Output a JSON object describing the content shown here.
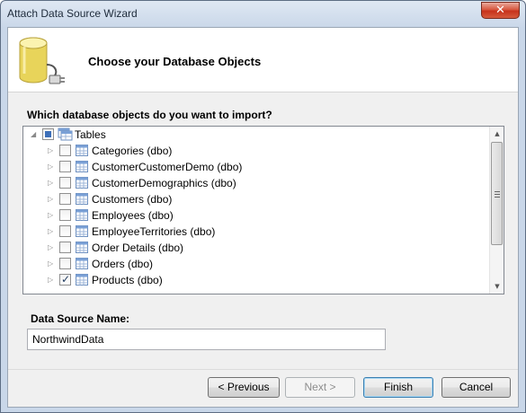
{
  "window": {
    "title": "Attach Data Source Wizard",
    "close_glyph": "✕"
  },
  "header": {
    "title": "Choose your Database Objects",
    "icon": "database-connection-icon"
  },
  "tree": {
    "question": "Which database objects do you want to import?",
    "root": {
      "label": "Tables",
      "state": "partial",
      "expanded": true
    },
    "items": [
      {
        "label": "Categories (dbo)",
        "checked": false
      },
      {
        "label": "CustomerCustomerDemo (dbo)",
        "checked": false
      },
      {
        "label": "CustomerDemographics (dbo)",
        "checked": false
      },
      {
        "label": "Customers (dbo)",
        "checked": false
      },
      {
        "label": "Employees (dbo)",
        "checked": false
      },
      {
        "label": "EmployeeTerritories (dbo)",
        "checked": false
      },
      {
        "label": "Order Details (dbo)",
        "checked": false
      },
      {
        "label": "Orders (dbo)",
        "checked": false
      },
      {
        "label": "Products (dbo)",
        "checked": true
      }
    ]
  },
  "datasource": {
    "label": "Data Source Name:",
    "value": "NorthwindData"
  },
  "buttons": {
    "previous": "< Previous",
    "next": "Next >",
    "finish": "Finish",
    "cancel": "Cancel"
  },
  "colors": {
    "title_gradient_top": "#dfe8f3",
    "close_red": "#c7321b",
    "checkbox_fill": "#3d6fb8"
  }
}
